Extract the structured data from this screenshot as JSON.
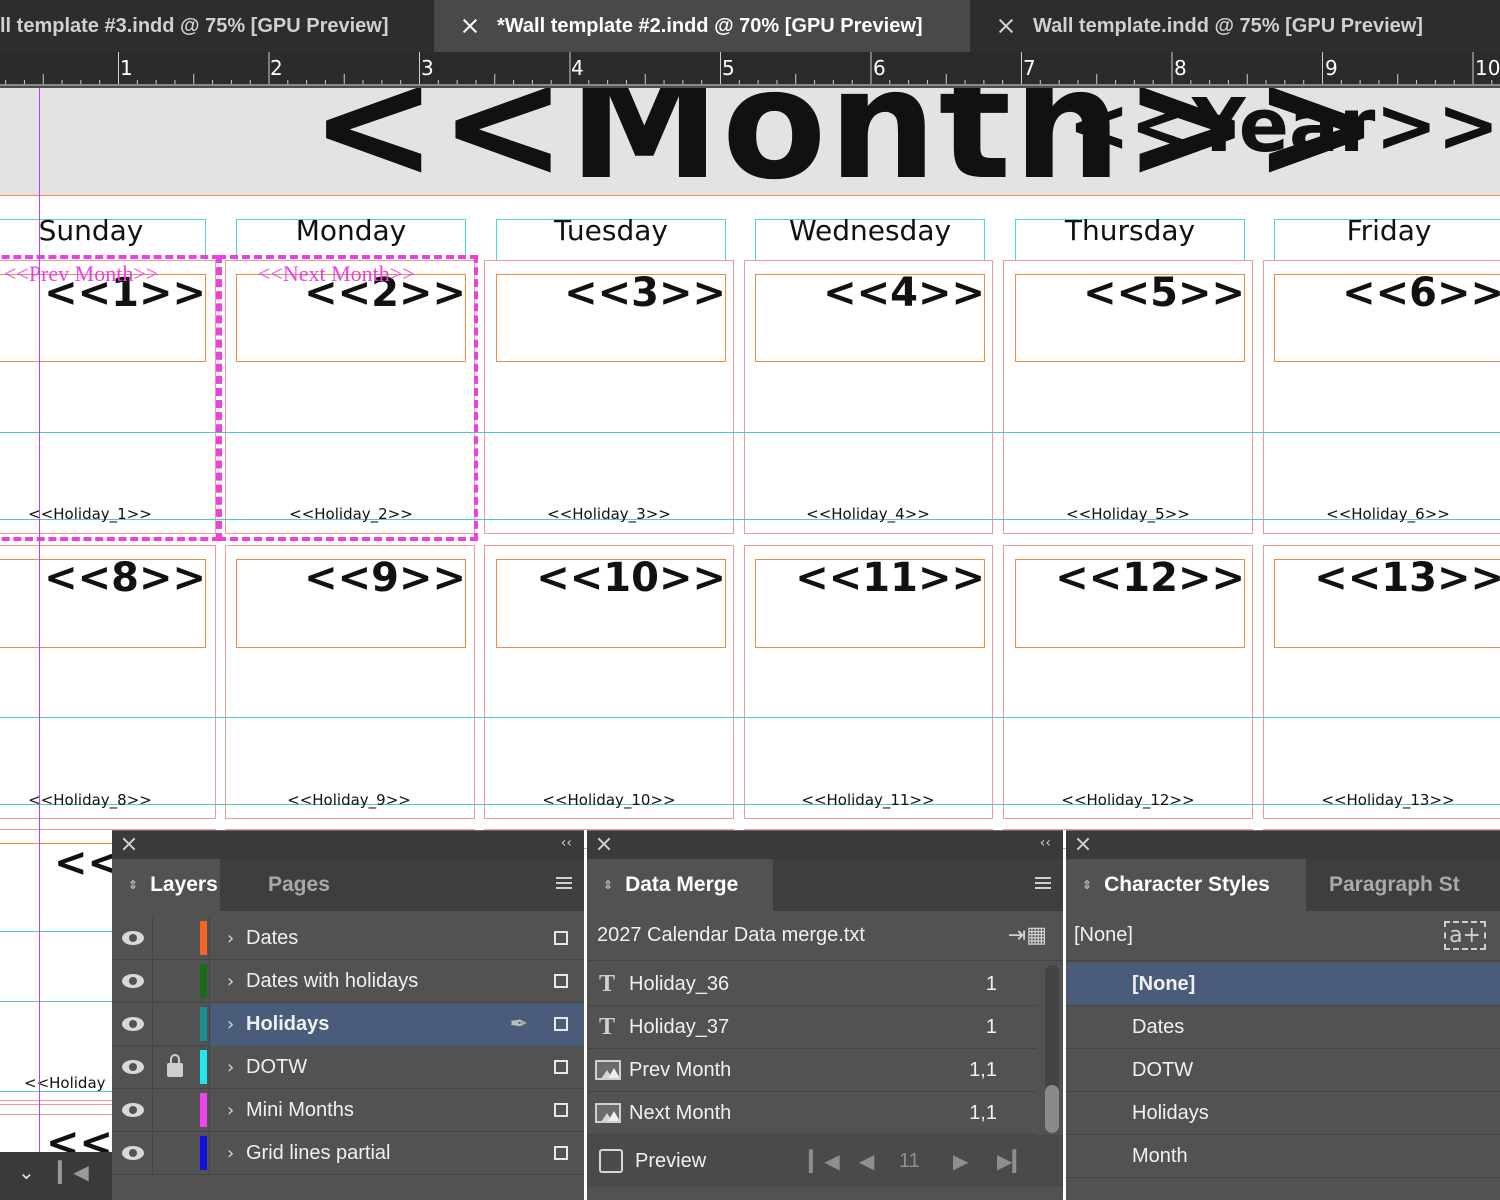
{
  "tabs": [
    {
      "label": "ll template #3.indd @ 75% [GPU Preview]",
      "active": false
    },
    {
      "label": "*Wall template #2.indd @ 70% [GPU Preview]",
      "active": true
    },
    {
      "label": "Wall template.indd @ 75% [GPU Preview]",
      "active": false
    }
  ],
  "ruler": [
    "1",
    "2",
    "3",
    "4",
    "5",
    "6",
    "7",
    "8",
    "9",
    "10"
  ],
  "document": {
    "month_placeholder": "<<Month>>",
    "year_placeholder": "<<Year>>",
    "weekdays": [
      "Sunday",
      "Monday",
      "Tuesday",
      "Wednesday",
      "Thursday",
      "Friday"
    ],
    "prev_month_label": "<<Prev Month>>",
    "next_month_label": "<<Next Month>>",
    "week1": {
      "days": [
        "<<1>>",
        "<<2>>",
        "<<3>>",
        "<<4>>",
        "<<5>>",
        "<<6>>"
      ],
      "holidays": [
        "<<Holiday_1>>",
        "<<Holiday_2>>",
        "<<Holiday_3>>",
        "<<Holiday_4>>",
        "<<Holiday_5>>",
        "<<Holiday_6>>"
      ]
    },
    "week2": {
      "days": [
        "<<8>>",
        "<<9>>",
        "<<10>>",
        "<<11>>",
        "<<12>>",
        "<<13>>"
      ],
      "holidays": [
        "<<Holiday_8>>",
        "<<Holiday_9>>",
        "<<Holiday_10>>",
        "<<Holiday_11>>",
        "<<Holiday_12>>",
        "<<Holiday_13>>"
      ]
    },
    "week3_partial_day": "<<",
    "week3_partial_holiday": "<<Holiday",
    "week4_partial_day": "<<"
  },
  "layers_panel": {
    "tabs": [
      "Layers",
      "Pages"
    ],
    "layers": [
      {
        "name": "Dates",
        "color": "#f26522",
        "locked": false,
        "selected": false
      },
      {
        "name": "Dates with holidays",
        "color": "#1a6b1a",
        "locked": false,
        "selected": false
      },
      {
        "name": "Holidays",
        "color": "#1a9090",
        "locked": false,
        "selected": true
      },
      {
        "name": "DOTW",
        "color": "#22e8f0",
        "locked": true,
        "selected": false
      },
      {
        "name": "Mini Months",
        "color": "#ee44ee",
        "locked": false,
        "selected": false
      },
      {
        "name": "Grid lines partial",
        "color": "#1010e0",
        "locked": false,
        "selected": false
      }
    ]
  },
  "data_merge_panel": {
    "title": "Data Merge",
    "source": "2027 Calendar Data merge.txt",
    "fields": [
      {
        "type": "text",
        "name": "Holiday_36",
        "count": "1"
      },
      {
        "type": "text",
        "name": "Holiday_37",
        "count": "1"
      },
      {
        "type": "image",
        "name": "Prev Month",
        "count": "1,1"
      },
      {
        "type": "image",
        "name": "Next Month",
        "count": "1,1"
      }
    ],
    "preview_label": "Preview",
    "record": "11"
  },
  "styles_panel": {
    "tabs": [
      "Character Styles",
      "Paragraph St"
    ],
    "top_none": "[None]",
    "styles": [
      "[None]",
      "Dates",
      "DOTW",
      "Holidays",
      "Month"
    ]
  }
}
